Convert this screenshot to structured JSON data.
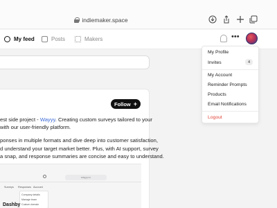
{
  "browser": {
    "url": "indiemaker.space"
  },
  "nav": {
    "tabs": [
      {
        "label": "My feed"
      },
      {
        "label": "Posts"
      },
      {
        "label": "Makers"
      }
    ]
  },
  "profile": {
    "section_title_fragment": "s",
    "follow_label": "Follow",
    "description_line1_prefix": "est side project - ",
    "description_link": "Wayyy",
    "description_line1_suffix": ". Creating custom surveys tailored to your",
    "description_line2": "with our user-friendly platform.",
    "description2_line1": "ponses in multiple formats and dive deep into customer satisfaction,",
    "description2_line2": "d understand your target market better. Plus, with AI support, survey",
    "description2_line3": "a snap, and response summaries are concise and easy to understand."
  },
  "preview": {
    "url": "wayyy.co",
    "tabs": [
      "Surveys",
      "Responses",
      "Account"
    ],
    "menu_items": [
      "Company details",
      "Manage team",
      "Custom domain"
    ],
    "title": "Dashby"
  },
  "menu": {
    "items": [
      {
        "label": "My Profile"
      },
      {
        "label": "Invites",
        "badge": "4"
      },
      {
        "label": "My Account"
      },
      {
        "label": "Reminder Prompts"
      },
      {
        "label": "Products"
      },
      {
        "label": "Email Notifications"
      },
      {
        "label": "Logout"
      }
    ]
  }
}
